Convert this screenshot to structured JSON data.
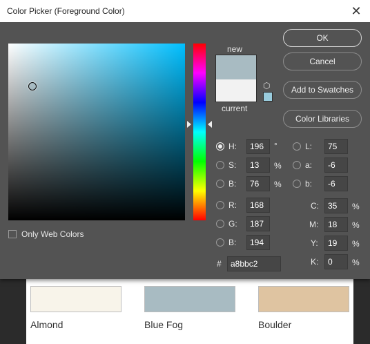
{
  "dialog": {
    "title": "Color Picker (Foreground Color)",
    "close_glyph": "✕",
    "new_label": "new",
    "current_label": "current",
    "only_web_colors": "Only Web Colors",
    "colors": {
      "new": "#a8bbc2",
      "current": "#f2f2f2"
    },
    "buttons": {
      "ok": "OK",
      "cancel": "Cancel",
      "add_to_swatches": "Add to Swatches",
      "color_libraries": "Color Libraries"
    },
    "hsb": {
      "h": {
        "label": "H:",
        "value": "196",
        "unit": "°"
      },
      "s": {
        "label": "S:",
        "value": "13",
        "unit": "%"
      },
      "b": {
        "label": "B:",
        "value": "76",
        "unit": "%"
      }
    },
    "lab": {
      "l": {
        "label": "L:",
        "value": "75"
      },
      "a": {
        "label": "a:",
        "value": "-6"
      },
      "b": {
        "label": "b:",
        "value": "-6"
      }
    },
    "rgb": {
      "r": {
        "label": "R:",
        "value": "168"
      },
      "g": {
        "label": "G:",
        "value": "187"
      },
      "b": {
        "label": "B:",
        "value": "194"
      }
    },
    "cmyk": {
      "c": {
        "label": "C:",
        "value": "35",
        "unit": "%"
      },
      "m": {
        "label": "M:",
        "value": "18",
        "unit": "%"
      },
      "y": {
        "label": "Y:",
        "value": "19",
        "unit": "%"
      },
      "k": {
        "label": "K:",
        "value": "0",
        "unit": "%"
      }
    },
    "hex": {
      "label": "#",
      "value": "a8bbc2"
    }
  },
  "background_swatches": [
    {
      "name": "Almond",
      "color": "#f8f4ea"
    },
    {
      "name": "Blue Fog",
      "color": "#a8bbc2"
    },
    {
      "name": "Boulder",
      "color": "#dfc4a1"
    }
  ]
}
